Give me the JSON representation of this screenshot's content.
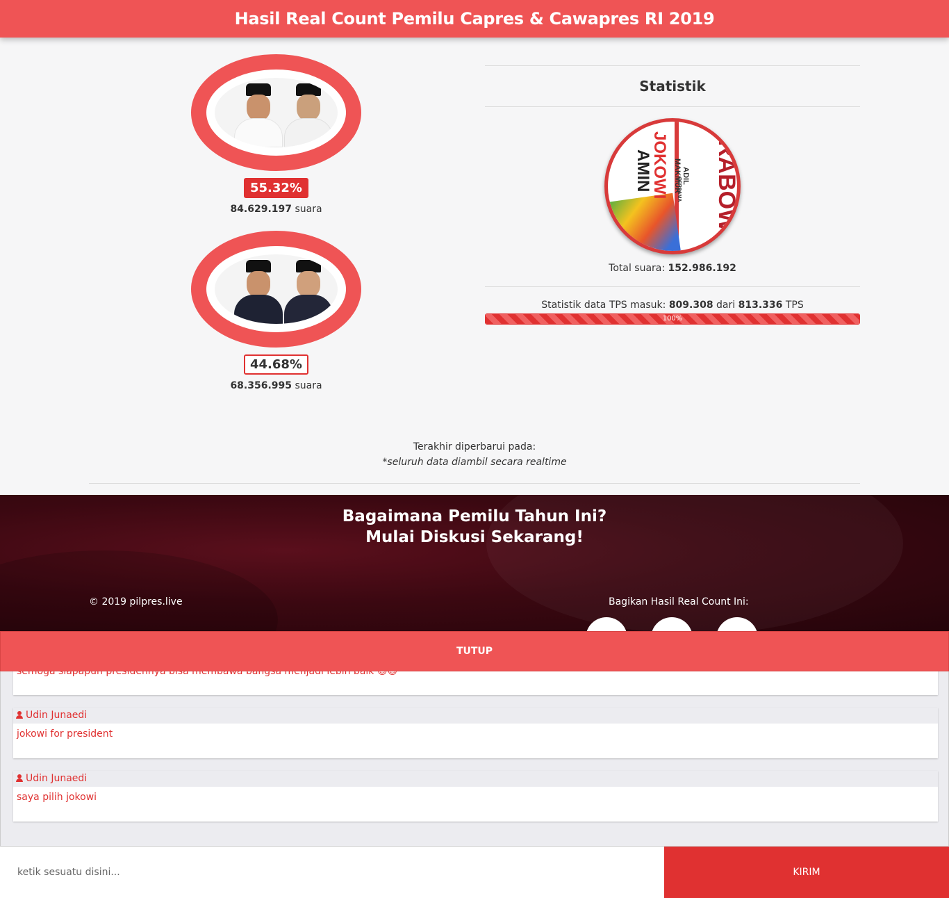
{
  "header": {
    "title": "Hasil Real Count Pemilu Capres & Cawapres RI 2019"
  },
  "candidates": [
    {
      "percent": "55.32%",
      "votes": "84.629.197",
      "votes_unit": "suara"
    },
    {
      "percent": "44.68%",
      "votes": "68.356.995",
      "votes_unit": "suara"
    }
  ],
  "stats": {
    "title": "Statistik",
    "total_label": "Total suara:",
    "total_value": "152.986.192",
    "tps_label": "Statistik data TPS masuk:",
    "tps_in": "809.308",
    "tps_of": "dari",
    "tps_total": "813.336",
    "tps_unit": "TPS",
    "progress_label": "100%",
    "progress_fraction": 1.0,
    "logo_texts": {
      "jokowi": "JOKOWI",
      "amin": "AMIN",
      "makmur": "ADIL MAKMUR",
      "bersama": "BERSAMA",
      "prabowo": "RABOW"
    }
  },
  "updated": {
    "label": "Terakhir diperbarui pada:",
    "note": "*seluruh data diambil secara realtime"
  },
  "footer": {
    "heading_line1": "Bagaimana Pemilu Tahun Ini?",
    "heading_line2": "Mulai Diskusi Sekarang!",
    "copyright": "© 2019 pilpres.live",
    "share_label": "Bagikan Hasil Real Count Ini:"
  },
  "close_label": "TUTUP",
  "comments": [
    {
      "text": "semoga siapapun presidennya bisa membawa bangsa menjadi lebih baik 😇😇"
    },
    {
      "user": "Udin Junaedi",
      "text": "jokowi for president"
    },
    {
      "user": "Udin Junaedi",
      "text": "saya pilih jokowi"
    }
  ],
  "input": {
    "placeholder": "ketik sesuatu disini...",
    "send_label": "KIRIM"
  },
  "colors": {
    "accent": "#ef5455",
    "red": "#e03131",
    "dark_band": "#3b0811"
  }
}
